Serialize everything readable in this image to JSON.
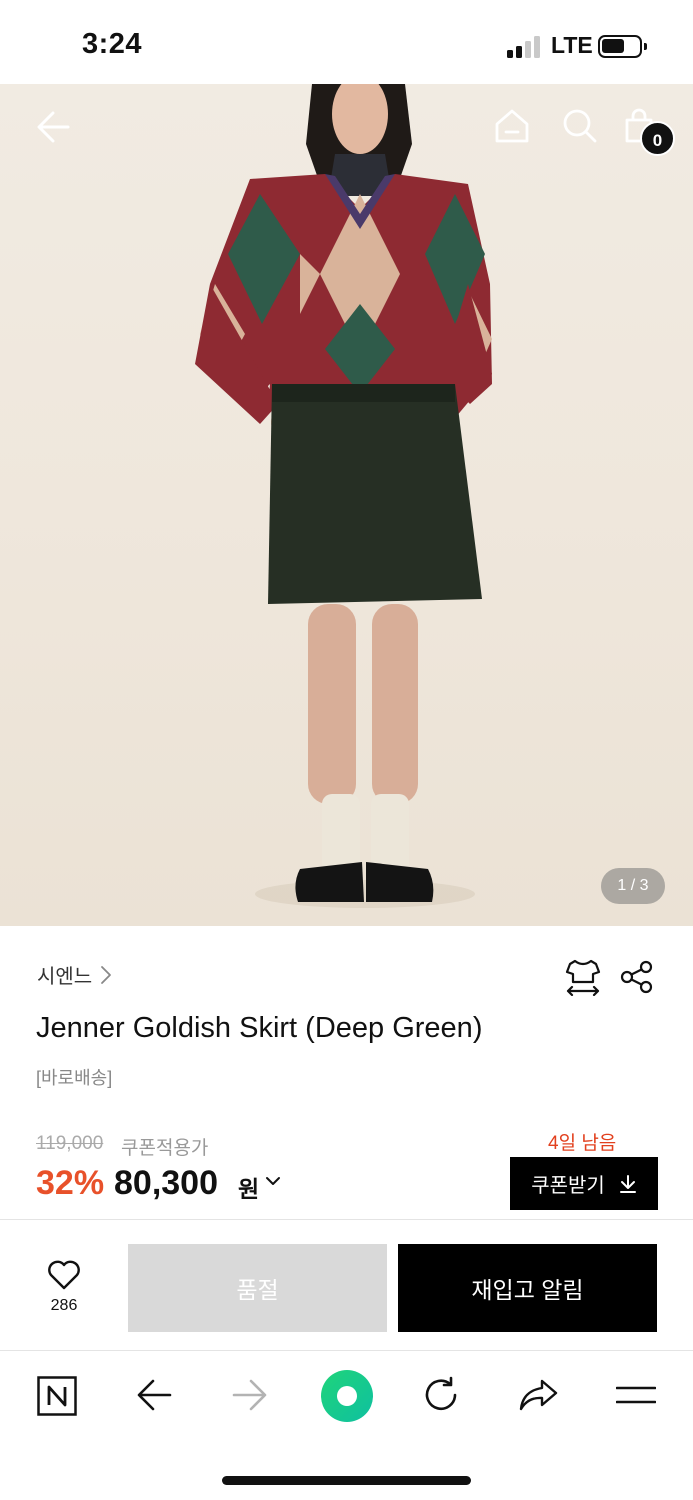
{
  "status_bar": {
    "time": "3:24",
    "network": "LTE",
    "signal_bars": 2,
    "battery_level": 0.6
  },
  "header": {
    "back_icon": "arrow-left-icon",
    "home_icon": "home-icon",
    "search_icon": "search-icon",
    "cart_icon": "shopping-bag-icon",
    "cart_count": "0"
  },
  "gallery": {
    "pager": "1 / 3"
  },
  "product": {
    "brand": "시엔느",
    "brand_chevron": ">",
    "title": "Jenner Goldish Skirt (Deep Green)",
    "tag": "[바로배송]",
    "original_price": "119,000",
    "coupon_price_label": "쿠폰적용가",
    "days_left": "4일 남음",
    "discount": "32%",
    "price": "80,300",
    "currency": "원",
    "coupon_button": "쿠폰받기",
    "accent_color": "#e8512a"
  },
  "actions": {
    "like_count": "286",
    "soldout_label": "품절",
    "restock_label": "재입고 알림"
  },
  "browser": {
    "buttons": [
      "naver-icon",
      "back-arrow-icon",
      "forward-arrow-icon",
      "green-dot-icon",
      "refresh-icon",
      "share-icon",
      "menu-icon"
    ]
  }
}
